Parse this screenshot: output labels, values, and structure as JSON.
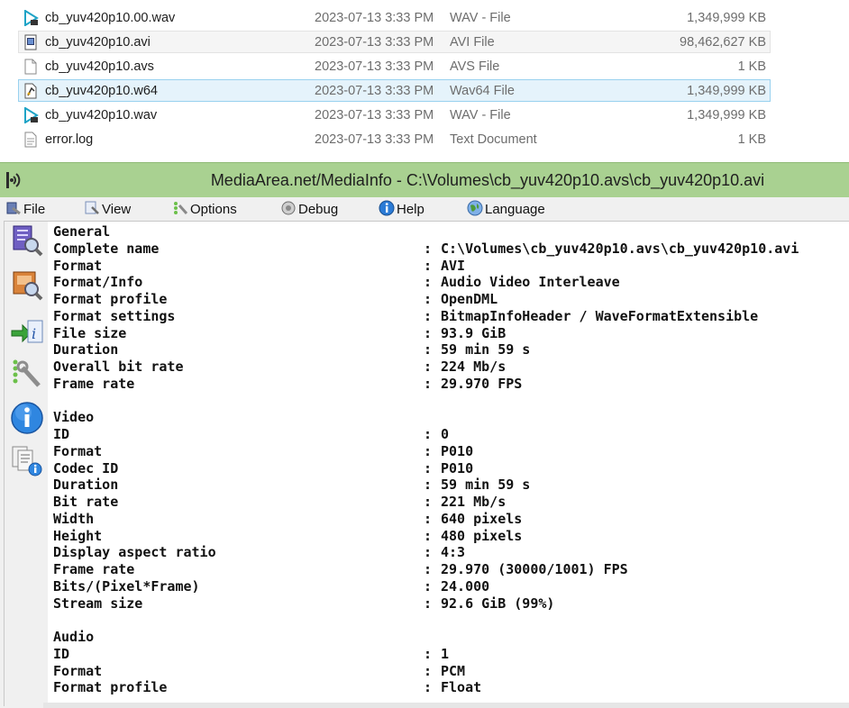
{
  "explorer": {
    "files": [
      {
        "name": "cb_yuv420p10.00.wav",
        "date": "2023-07-13 3:33 PM",
        "type": "WAV - File",
        "size": "1,349,999 KB",
        "icon": "wav-play-icon",
        "state": "none"
      },
      {
        "name": "cb_yuv420p10.avi",
        "date": "2023-07-13 3:33 PM",
        "type": "AVI File",
        "size": "98,462,627 KB",
        "icon": "video-file-icon",
        "state": "hover"
      },
      {
        "name": "cb_yuv420p10.avs",
        "date": "2023-07-13 3:33 PM",
        "type": "AVS File",
        "size": "1 KB",
        "icon": "blank-file-icon",
        "state": "none"
      },
      {
        "name": "cb_yuv420p10.w64",
        "date": "2023-07-13 3:33 PM",
        "type": "Wav64 File",
        "size": "1,349,999 KB",
        "icon": "media-file-icon",
        "state": "selected"
      },
      {
        "name": "cb_yuv420p10.wav",
        "date": "2023-07-13 3:33 PM",
        "type": "WAV - File",
        "size": "1,349,999 KB",
        "icon": "wav-play-icon",
        "state": "none"
      },
      {
        "name": "error.log",
        "date": "2023-07-13 3:33 PM",
        "type": "Text Document",
        "size": "1 KB",
        "icon": "text-file-icon",
        "state": "none"
      }
    ]
  },
  "mediainfo": {
    "title": "MediaArea.net/MediaInfo - C:\\Volumes\\cb_yuv420p10.avs\\cb_yuv420p10.avi",
    "menu": {
      "file": "File",
      "view": "View",
      "options": "Options",
      "debug": "Debug",
      "help": "Help",
      "language": "Language"
    },
    "lines": [
      {
        "k": "General",
        "v": ""
      },
      {
        "k": "Complete name",
        "v": "C:\\Volumes\\cb_yuv420p10.avs\\cb_yuv420p10.avi"
      },
      {
        "k": "Format",
        "v": "AVI"
      },
      {
        "k": "Format/Info",
        "v": "Audio Video Interleave"
      },
      {
        "k": "Format profile",
        "v": "OpenDML"
      },
      {
        "k": "Format settings",
        "v": "BitmapInfoHeader / WaveFormatExtensible"
      },
      {
        "k": "File size",
        "v": "93.9 GiB"
      },
      {
        "k": "Duration",
        "v": "59 min 59 s"
      },
      {
        "k": "Overall bit rate",
        "v": "224 Mb/s"
      },
      {
        "k": "Frame rate",
        "v": "29.970 FPS"
      },
      {
        "k": "",
        "v": ""
      },
      {
        "k": "Video",
        "v": ""
      },
      {
        "k": "ID",
        "v": "0"
      },
      {
        "k": "Format",
        "v": "P010"
      },
      {
        "k": "Codec ID",
        "v": "P010"
      },
      {
        "k": "Duration",
        "v": "59 min 59 s"
      },
      {
        "k": "Bit rate",
        "v": "221 Mb/s"
      },
      {
        "k": "Width",
        "v": "640 pixels"
      },
      {
        "k": "Height",
        "v": "480 pixels"
      },
      {
        "k": "Display aspect ratio",
        "v": "4:3"
      },
      {
        "k": "Frame rate",
        "v": "29.970 (30000/1001) FPS"
      },
      {
        "k": "Bits/(Pixel*Frame)",
        "v": "24.000"
      },
      {
        "k": "Stream size",
        "v": "92.6 GiB (99%)"
      },
      {
        "k": "",
        "v": ""
      },
      {
        "k": "Audio",
        "v": ""
      },
      {
        "k": "ID",
        "v": "1"
      },
      {
        "k": "Format",
        "v": "PCM"
      },
      {
        "k": "Format profile",
        "v": "Float"
      }
    ],
    "colon": ":"
  }
}
